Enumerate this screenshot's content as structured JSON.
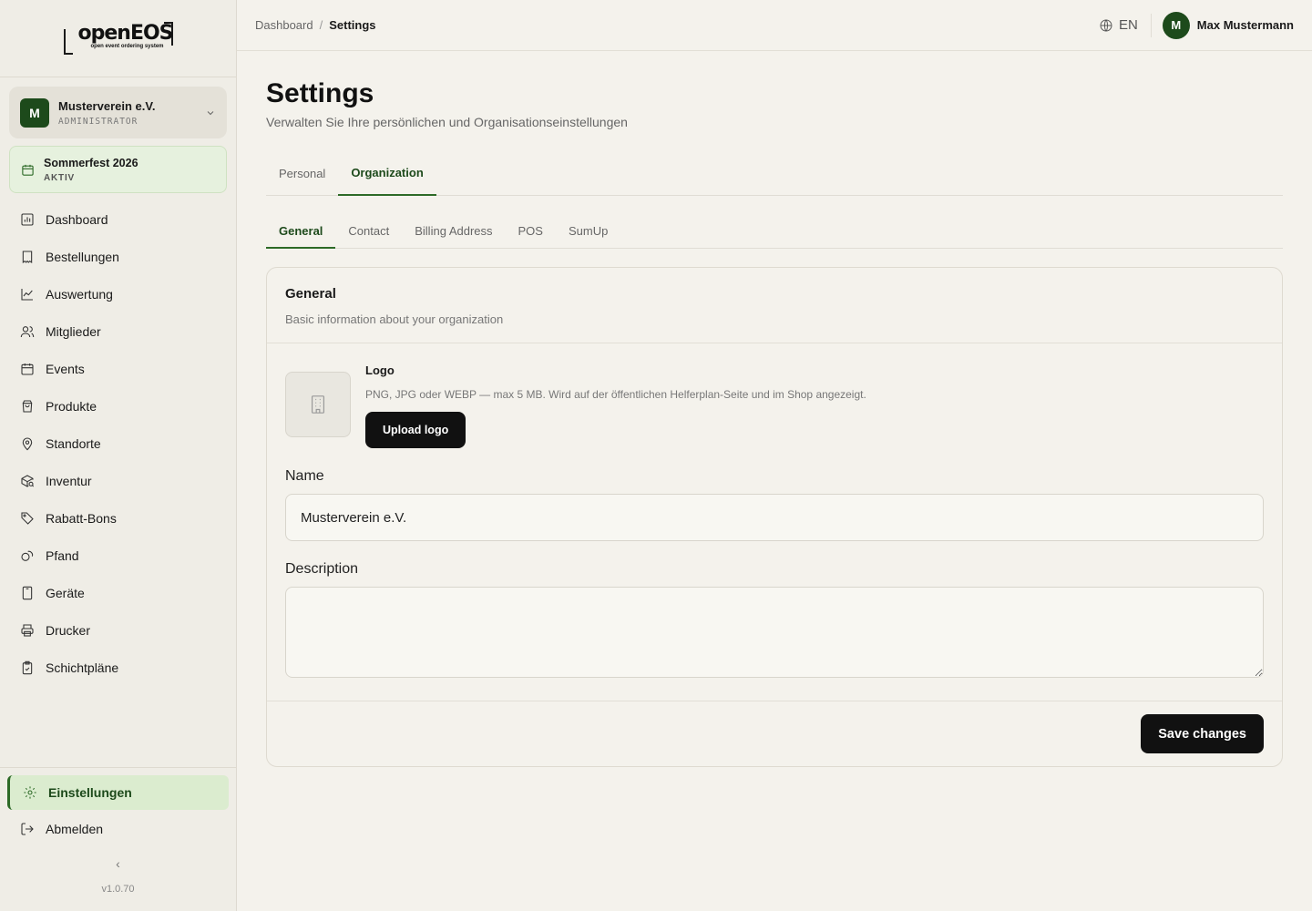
{
  "brand": {
    "logo_text": "openEOS",
    "logo_sub": "open event ordering system"
  },
  "org": {
    "initial": "M",
    "name": "Musterverein e.V.",
    "role": "ADMINISTRATOR"
  },
  "event": {
    "name": "Sommerfest 2026",
    "status": "AKTIV"
  },
  "nav": {
    "items": [
      {
        "label": "Dashboard",
        "icon": "chart-icon"
      },
      {
        "label": "Bestellungen",
        "icon": "receipt-icon"
      },
      {
        "label": "Auswertung",
        "icon": "line-chart-icon"
      },
      {
        "label": "Mitglieder",
        "icon": "users-icon"
      },
      {
        "label": "Events",
        "icon": "calendar-icon"
      },
      {
        "label": "Produkte",
        "icon": "shopping-bag-icon"
      },
      {
        "label": "Standorte",
        "icon": "map-pin-icon"
      },
      {
        "label": "Inventur",
        "icon": "package-search-icon"
      },
      {
        "label": "Rabatt-Bons",
        "icon": "tag-icon"
      },
      {
        "label": "Pfand",
        "icon": "coins-icon"
      },
      {
        "label": "Geräte",
        "icon": "tablet-icon"
      },
      {
        "label": "Drucker",
        "icon": "printer-icon"
      },
      {
        "label": "Schichtpläne",
        "icon": "clipboard-check-icon"
      }
    ],
    "settings": "Einstellungen",
    "logout": "Abmelden",
    "collapse": "‹",
    "version": "v1.0.70"
  },
  "topbar": {
    "breadcrumb_root": "Dashboard",
    "breadcrumb_sep": "/",
    "breadcrumb_current": "Settings",
    "lang": "EN",
    "user_initial": "M",
    "user_name": "Max Mustermann"
  },
  "page": {
    "title": "Settings",
    "subtitle": "Verwalten Sie Ihre persönlichen und Organisationseinstellungen",
    "tabs": [
      "Personal",
      "Organization"
    ],
    "active_tab": "Organization",
    "subtabs": [
      "General",
      "Contact",
      "Billing Address",
      "POS",
      "SumUp"
    ],
    "active_subtab": "General"
  },
  "card": {
    "title": "General",
    "description": "Basic information about your organization",
    "logo_label": "Logo",
    "logo_hint": "PNG, JPG oder WEBP — max 5 MB. Wird auf der öffentlichen Helferplan-Seite und im Shop angezeigt.",
    "upload_label": "Upload logo",
    "name_label": "Name",
    "name_value": "Musterverein e.V.",
    "description_label": "Description",
    "description_value": "",
    "save_label": "Save changes"
  },
  "colors": {
    "accent": "#2d6a27",
    "accent_dark": "#1d4a1b",
    "active_bg": "#dbeccf",
    "background": "#f4f2ec"
  }
}
